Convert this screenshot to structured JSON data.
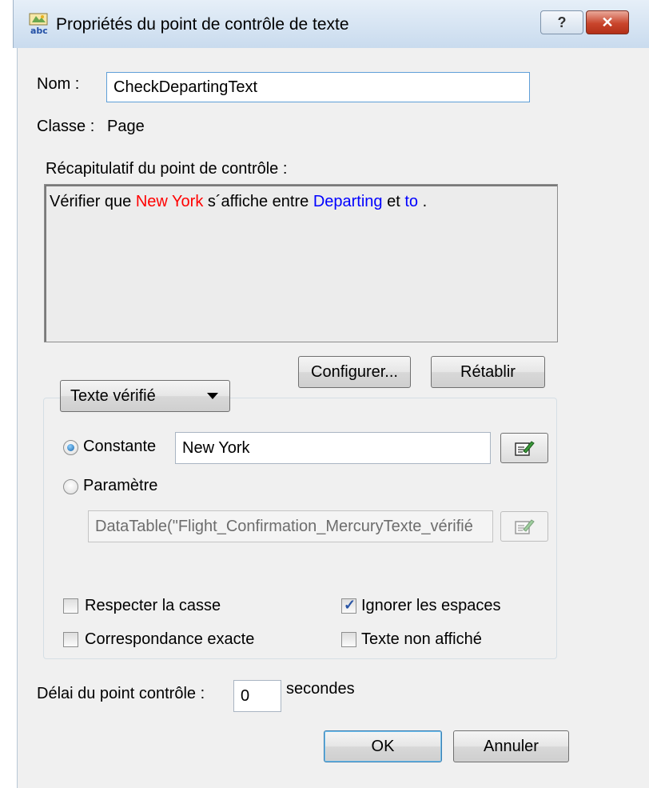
{
  "window": {
    "title": "Propriétés du point de contrôle de texte",
    "help_label": "?",
    "close_label": "✕"
  },
  "name": {
    "label": "Nom :",
    "value": "CheckDepartingText"
  },
  "class": {
    "label": "Classe :",
    "value": "Page"
  },
  "summary": {
    "label": "Récapitulatif du point de contrôle :",
    "text_before": "Vérifier que ",
    "checked_text": "New York",
    "text_middle": " s´affiche entre ",
    "text_before_word": "Departing",
    "text_and": " et  ",
    "text_after_word": "to",
    "text_end": " ."
  },
  "buttons": {
    "configure": "Configurer...",
    "reset": "Rétablir",
    "ok": "OK",
    "cancel": "Annuler"
  },
  "checked_text_select": {
    "selected": "Texte vérifié"
  },
  "constant": {
    "label": "Constante",
    "value": "New York",
    "selected": true
  },
  "parameter": {
    "label": "Paramètre",
    "value": "DataTable(\"Flight_Confirmation_MercuryTexte_vérifié",
    "selected": false
  },
  "options": {
    "match_case": {
      "label": "Respecter la casse",
      "checked": false
    },
    "ignore_spaces": {
      "label": "Ignorer les espaces",
      "checked": true
    },
    "exact_match": {
      "label": "Correspondance exacte",
      "checked": false
    },
    "text_not_displayed": {
      "label": "Texte non affiché",
      "checked": false
    }
  },
  "timeout": {
    "label": "Délai du point contrôle :",
    "value": "0",
    "unit": "secondes"
  }
}
